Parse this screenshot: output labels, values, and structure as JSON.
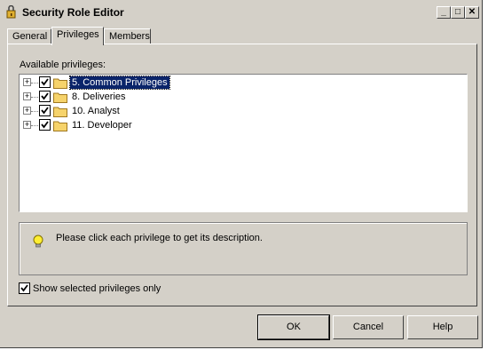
{
  "window": {
    "title": "Security Role Editor"
  },
  "title_buttons": {
    "minimize": "_",
    "maximize": "□",
    "close": "✕"
  },
  "tabs": [
    {
      "label": "General"
    },
    {
      "label": "Privileges"
    },
    {
      "label": "Members"
    }
  ],
  "privileges": {
    "label": "Available privileges:",
    "items": [
      {
        "label": "5. Common Privileges",
        "checked": true,
        "selected": true
      },
      {
        "label": "8. Deliveries",
        "checked": true,
        "selected": false
      },
      {
        "label": "10. Analyst",
        "checked": true,
        "selected": false
      },
      {
        "label": "11. Developer",
        "checked": true,
        "selected": false
      }
    ]
  },
  "description": {
    "text": "Please click each privilege to get its description."
  },
  "options": {
    "show_selected_label": "Show selected privileges only",
    "show_selected_checked": true
  },
  "buttons": {
    "ok": "OK",
    "cancel": "Cancel",
    "help": "Help"
  },
  "colors": {
    "face": "#d4d0c8",
    "selection": "#0a246a",
    "folder": "#f6d36b"
  }
}
